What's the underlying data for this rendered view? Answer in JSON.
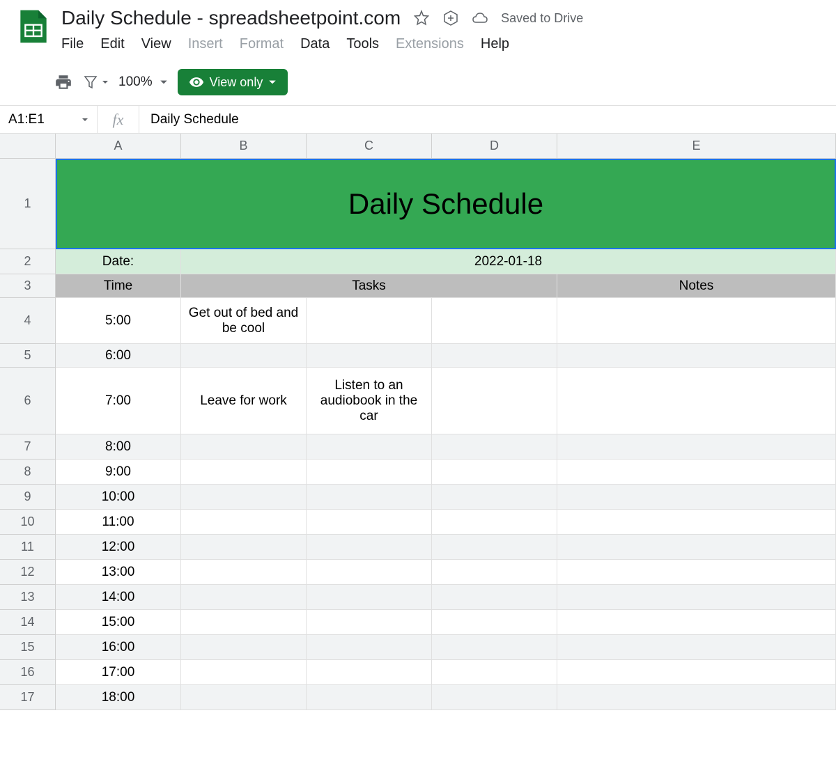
{
  "header": {
    "title": "Daily Schedule - spreadsheetpoint.com",
    "saved_status": "Saved to Drive"
  },
  "menu": {
    "file": "File",
    "edit": "Edit",
    "view": "View",
    "insert": "Insert",
    "format": "Format",
    "data": "Data",
    "tools": "Tools",
    "extensions": "Extensions",
    "help": "Help"
  },
  "toolbar": {
    "zoom": "100%",
    "view_only": "View only"
  },
  "formula_bar": {
    "cell_ref": "A1:E1",
    "formula_value": "Daily Schedule"
  },
  "columns": [
    "A",
    "B",
    "C",
    "D",
    "E"
  ],
  "row_numbers": [
    "1",
    "2",
    "3",
    "4",
    "5",
    "6",
    "7",
    "8",
    "9",
    "10",
    "11",
    "12",
    "13",
    "14",
    "15",
    "16",
    "17"
  ],
  "sheet": {
    "title_cell": "Daily Schedule",
    "date_label": "Date:",
    "date_value": "2022-01-18",
    "header_time": "Time",
    "header_tasks": "Tasks",
    "header_notes": "Notes",
    "rows": [
      {
        "time": "5:00",
        "b": "Get out of bed and be cool",
        "c": "",
        "d": "",
        "e": "",
        "height": "h-66",
        "alt": false
      },
      {
        "time": "6:00",
        "b": "",
        "c": "",
        "d": "",
        "e": "",
        "height": "h-34",
        "alt": true
      },
      {
        "time": "7:00",
        "b": "Leave for work",
        "c": "Listen to  an audiobook in the car",
        "d": "",
        "e": "",
        "height": "h-96",
        "alt": false
      },
      {
        "time": "8:00",
        "b": "",
        "c": "",
        "d": "",
        "e": "",
        "height": "h-36",
        "alt": true
      },
      {
        "time": "9:00",
        "b": "",
        "c": "",
        "d": "",
        "e": "",
        "height": "h-36",
        "alt": false
      },
      {
        "time": "10:00",
        "b": "",
        "c": "",
        "d": "",
        "e": "",
        "height": "h-36",
        "alt": true
      },
      {
        "time": "11:00",
        "b": "",
        "c": "",
        "d": "",
        "e": "",
        "height": "h-36",
        "alt": false
      },
      {
        "time": "12:00",
        "b": "",
        "c": "",
        "d": "",
        "e": "",
        "height": "h-36",
        "alt": true
      },
      {
        "time": "13:00",
        "b": "",
        "c": "",
        "d": "",
        "e": "",
        "height": "h-36",
        "alt": false
      },
      {
        "time": "14:00",
        "b": "",
        "c": "",
        "d": "",
        "e": "",
        "height": "h-36",
        "alt": true
      },
      {
        "time": "15:00",
        "b": "",
        "c": "",
        "d": "",
        "e": "",
        "height": "h-36",
        "alt": false
      },
      {
        "time": "16:00",
        "b": "",
        "c": "",
        "d": "",
        "e": "",
        "height": "h-36",
        "alt": true
      },
      {
        "time": "17:00",
        "b": "",
        "c": "",
        "d": "",
        "e": "",
        "height": "h-36",
        "alt": false
      },
      {
        "time": "18:00",
        "b": "",
        "c": "",
        "d": "",
        "e": "",
        "height": "h-36",
        "alt": true
      }
    ]
  }
}
